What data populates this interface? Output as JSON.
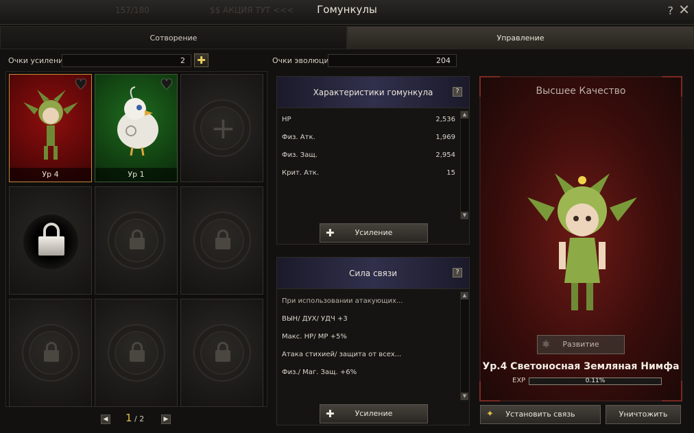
{
  "window": {
    "title": "Гомункулы",
    "ghost_text_1": "$$ АКЦИЯ ТУТ <<<",
    "ghost_text_2": "157/180"
  },
  "tabs": [
    {
      "label": "Сотворение",
      "active": false
    },
    {
      "label": "Управление",
      "active": true
    }
  ],
  "points": {
    "boost_label": "Очки усиления",
    "boost_value": "2",
    "evolution_label": "Очки эволюции",
    "evolution_value": "204"
  },
  "slots": [
    {
      "state": "pet",
      "level": "Ур 4",
      "bg": "#8f0e0e",
      "selected": true
    },
    {
      "state": "pet",
      "level": "Ур 1",
      "bg": "#1f6b1f",
      "selected": false
    },
    {
      "state": "empty"
    },
    {
      "state": "locked-active"
    },
    {
      "state": "locked"
    },
    {
      "state": "locked"
    },
    {
      "state": "locked"
    },
    {
      "state": "locked"
    },
    {
      "state": "locked"
    }
  ],
  "pager": {
    "current": "1",
    "total": "/ 2"
  },
  "stats_panel": {
    "title": "Характеристики гомункула",
    "rows": [
      {
        "k": "HP",
        "v": "2,536"
      },
      {
        "k": "Физ. Атк.",
        "v": "1,969"
      },
      {
        "k": "Физ. Защ.",
        "v": "2,954"
      },
      {
        "k": "Крит. Атк.",
        "v": "15"
      }
    ],
    "button": "Усиление"
  },
  "bond_panel": {
    "title": "Сила связи",
    "rows": [
      "При использовании атакующих...",
      "ВЫН/ ДУХ/ УДЧ +3",
      "Макс. HP/ MP +5%",
      "Атака стихией/ защита от всех...",
      "Физ./ Маг. Защ. +6%"
    ],
    "button": "Усиление"
  },
  "card": {
    "quality": "Высшее Качество",
    "evolve_button": "Развитие",
    "pet_name": "Ур.4 Светоносная Земляная Нимфа",
    "exp_label": "EXP",
    "exp_text": "0.11%",
    "exp_fraction": 0.0011
  },
  "bottom_buttons": {
    "bond": "Установить связь",
    "destroy": "Уничтожить"
  },
  "colors": {
    "accent_gold": "#e2c14a",
    "selected_bg": "#8f0e0e",
    "green_bg": "#1f6b1f"
  }
}
